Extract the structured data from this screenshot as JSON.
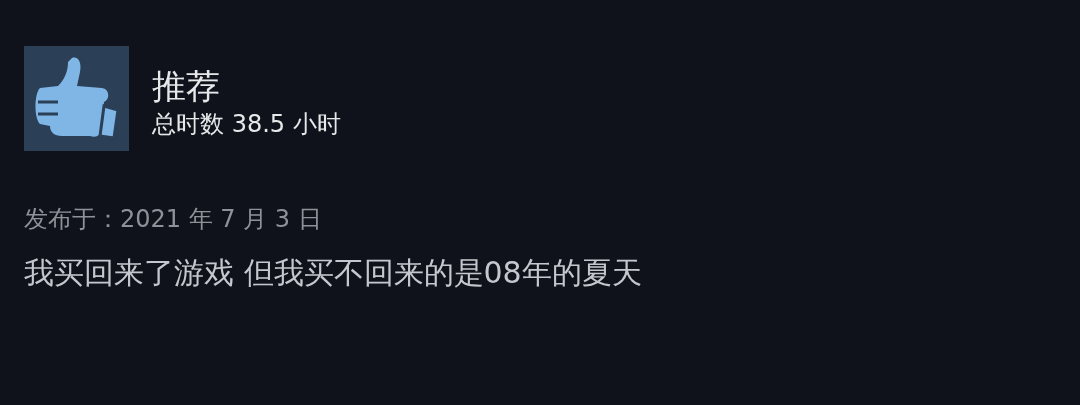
{
  "review": {
    "verdict": "推荐",
    "hours": "总时数 38.5 小时",
    "posted": "发布于：2021 年 7 月 3 日",
    "text": "我买回来了游戏 但我买不回来的是08年的夏天"
  }
}
